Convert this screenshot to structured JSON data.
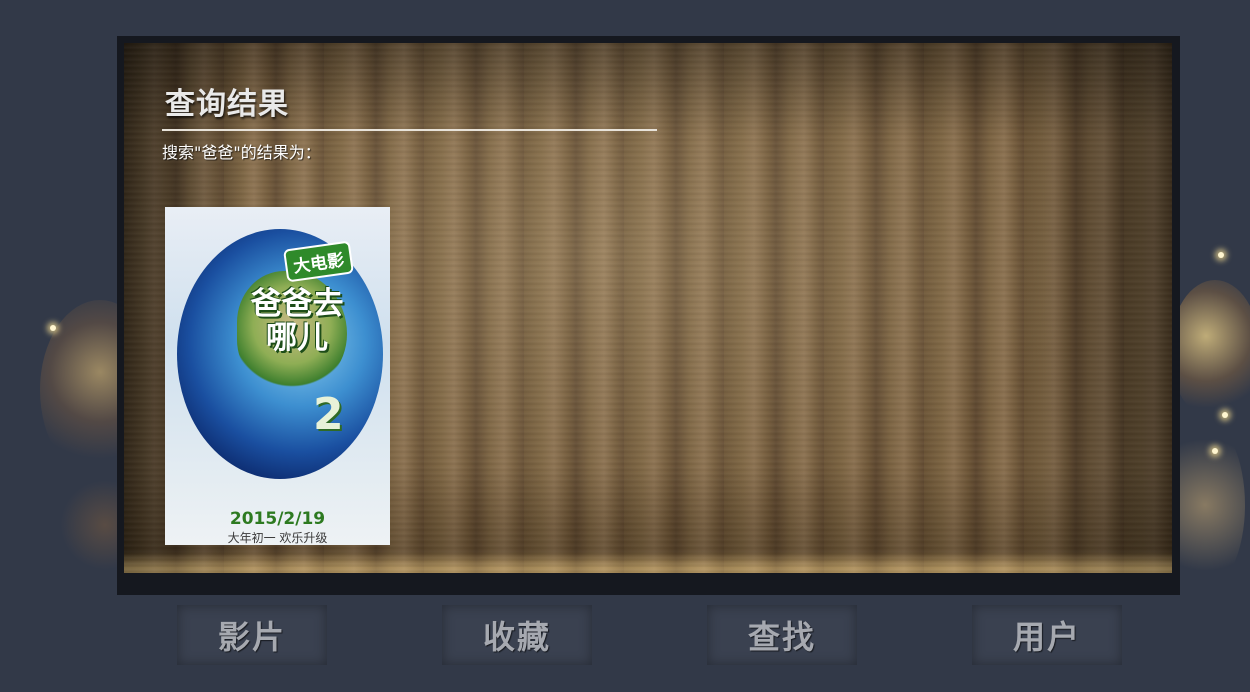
{
  "results": {
    "title": "查询结果",
    "query_text": "搜索\"爸爸\"的结果为：",
    "items": [
      {
        "badge": "大电影",
        "name": "爸爸去哪儿",
        "sequel": "2",
        "date": "2015/2/19",
        "slogan": "大年初一 欢乐升级"
      }
    ]
  },
  "nav": {
    "items": [
      {
        "label": "影片"
      },
      {
        "label": "收藏"
      },
      {
        "label": "查找"
      },
      {
        "label": "用户"
      }
    ]
  },
  "colors": {
    "background": "#323948",
    "panel_frame": "#15181f",
    "nav_button": "#3a4150",
    "nav_text": "#a6a9b0",
    "title_text": "#e9e9e9"
  }
}
